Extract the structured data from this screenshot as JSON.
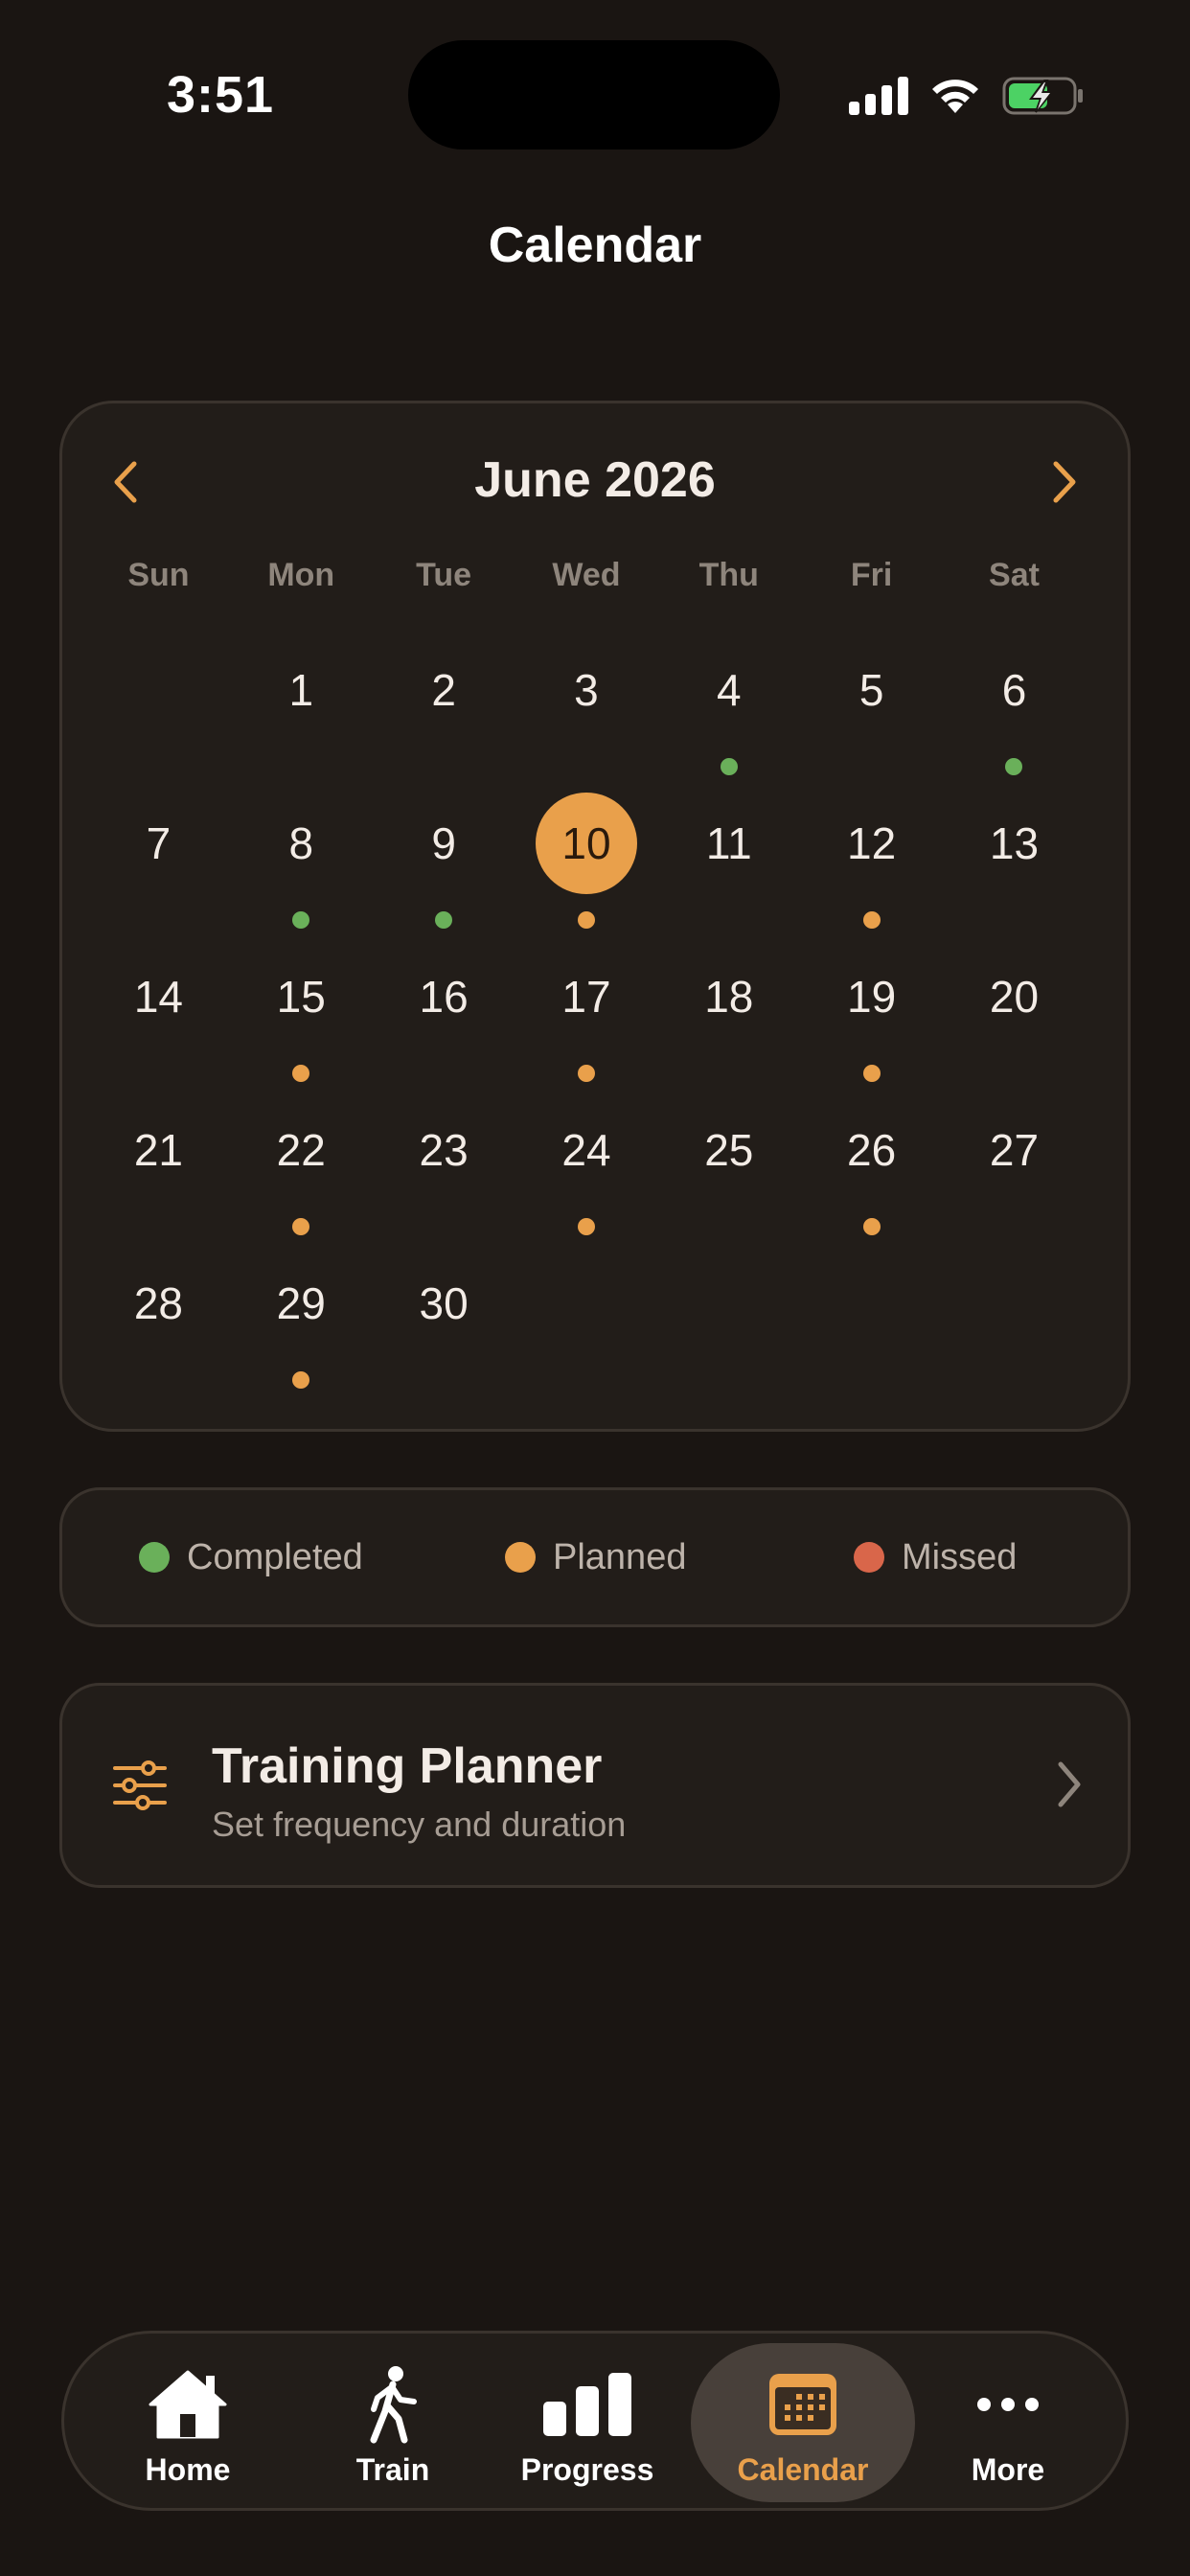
{
  "status_bar": {
    "time": "3:51"
  },
  "header": {
    "title": "Calendar"
  },
  "calendar": {
    "month_title": "June 2026",
    "weekdays": [
      "Sun",
      "Mon",
      "Tue",
      "Wed",
      "Thu",
      "Fri",
      "Sat"
    ],
    "leading_blanks": 1,
    "today": 10,
    "days": [
      {
        "n": "1",
        "status": ""
      },
      {
        "n": "2",
        "status": ""
      },
      {
        "n": "3",
        "status": ""
      },
      {
        "n": "4",
        "status": "completed"
      },
      {
        "n": "5",
        "status": ""
      },
      {
        "n": "6",
        "status": "completed"
      },
      {
        "n": "7",
        "status": ""
      },
      {
        "n": "8",
        "status": "completed"
      },
      {
        "n": "9",
        "status": "completed"
      },
      {
        "n": "10",
        "status": "planned"
      },
      {
        "n": "11",
        "status": ""
      },
      {
        "n": "12",
        "status": "planned"
      },
      {
        "n": "13",
        "status": ""
      },
      {
        "n": "14",
        "status": ""
      },
      {
        "n": "15",
        "status": "planned"
      },
      {
        "n": "16",
        "status": ""
      },
      {
        "n": "17",
        "status": "planned"
      },
      {
        "n": "18",
        "status": ""
      },
      {
        "n": "19",
        "status": "planned"
      },
      {
        "n": "20",
        "status": ""
      },
      {
        "n": "21",
        "status": ""
      },
      {
        "n": "22",
        "status": "planned"
      },
      {
        "n": "23",
        "status": ""
      },
      {
        "n": "24",
        "status": "planned"
      },
      {
        "n": "25",
        "status": ""
      },
      {
        "n": "26",
        "status": "planned"
      },
      {
        "n": "27",
        "status": ""
      },
      {
        "n": "28",
        "status": ""
      },
      {
        "n": "29",
        "status": "planned"
      },
      {
        "n": "30",
        "status": ""
      }
    ]
  },
  "legend": {
    "completed_label": "Completed",
    "planned_label": "Planned",
    "missed_label": "Missed"
  },
  "colors": {
    "completed": "#6ab05a",
    "planned": "#e9a04b",
    "missed": "#d9664a",
    "accent": "#e9a04b"
  },
  "planner": {
    "title": "Training Planner",
    "subtitle": "Set frequency and duration"
  },
  "tabbar": {
    "home_label": "Home",
    "train_label": "Train",
    "progress_label": "Progress",
    "calendar_label": "Calendar",
    "more_label": "More",
    "active": "calendar"
  },
  "icons": {
    "prev": "chevron-left-icon",
    "next": "chevron-right-icon",
    "planner": "sliders-icon",
    "home": "house-icon",
    "train": "walking-person-icon",
    "progress": "bar-chart-icon",
    "calendar": "calendar-icon",
    "more": "ellipsis-icon"
  }
}
